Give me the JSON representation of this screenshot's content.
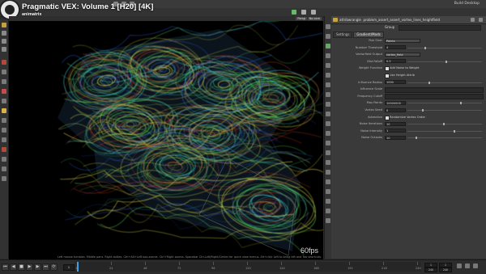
{
  "video": {
    "title": "Pragmatic VEX: Volume 1 [H20] [4K]",
    "channel": "animatrix"
  },
  "app": {
    "top_right": "Build Desktop"
  },
  "viewport": {
    "buttons": [
      "Persp",
      "No cam"
    ],
    "status_text": "Left mouse tumbles. Middle pans. Right dollies. Ctrl+Alt+Left box-zooms. Ctrl+Right zooms. Spacebar Ctrl-Left/Right/Center for quick view menus. Alt+click Left to bring left and Tab shortcuts.",
    "fps": "60fps"
  },
  "params": {
    "node_path": "problem_assert_assert_vortex_lines_heightfield",
    "node_type": "attribwrangle",
    "search_label": "Group",
    "tabs": [
      "Settings",
      "Gradient/Mods"
    ],
    "rows": [
      {
        "label": "Run Over",
        "value": "Points",
        "kind": "menu"
      },
      {
        "label": "Number Threshold",
        "value": "4",
        "kind": "field"
      },
      {
        "label": "Vectorfield Output",
        "value": "vortex_field",
        "kind": "menu"
      },
      {
        "label": "Dist Falloff",
        "value": "0.5",
        "kind": "field"
      },
      {
        "label": "Weight Function",
        "value": "",
        "kind": "check",
        "check_label": "Add Noise to Weight"
      },
      {
        "label": "",
        "value": "",
        "kind": "check",
        "check_label": "Use Height Attrib"
      },
      {
        "label": "Influence Radius",
        "value": "1000",
        "kind": "field"
      },
      {
        "label": "Influence Scale",
        "value": "",
        "kind": "long"
      },
      {
        "label": "Frequency Cutoff",
        "value": "",
        "kind": "long"
      },
      {
        "label": "Max Points",
        "value": "10000000",
        "kind": "field"
      },
      {
        "label": "Vortex Seed",
        "value": "0",
        "kind": "field"
      },
      {
        "label": "Advection",
        "value": "",
        "kind": "check",
        "check_label": "Randomize Vortex Order"
      },
      {
        "label": "Noise Iterations",
        "value": "10",
        "kind": "field"
      },
      {
        "label": "Noise Intensity",
        "value": "1",
        "kind": "field"
      },
      {
        "label": "Noise Octaves",
        "value": "10",
        "kind": "field"
      }
    ]
  },
  "timeline": {
    "current_frame": "1",
    "ticks": [
      "1",
      "24",
      "48",
      "72",
      "96",
      "120",
      "144",
      "168",
      "192",
      "216",
      "240"
    ],
    "start": "1",
    "end": "240"
  },
  "colors": {
    "accent": "#3aa1e8",
    "flow_yellow": "#e6e34a",
    "flow_green": "#4ed35a",
    "flow_cyan": "#3fd8e0",
    "flow_blue": "#2b5bd8",
    "flow_red": "#d2402a"
  }
}
